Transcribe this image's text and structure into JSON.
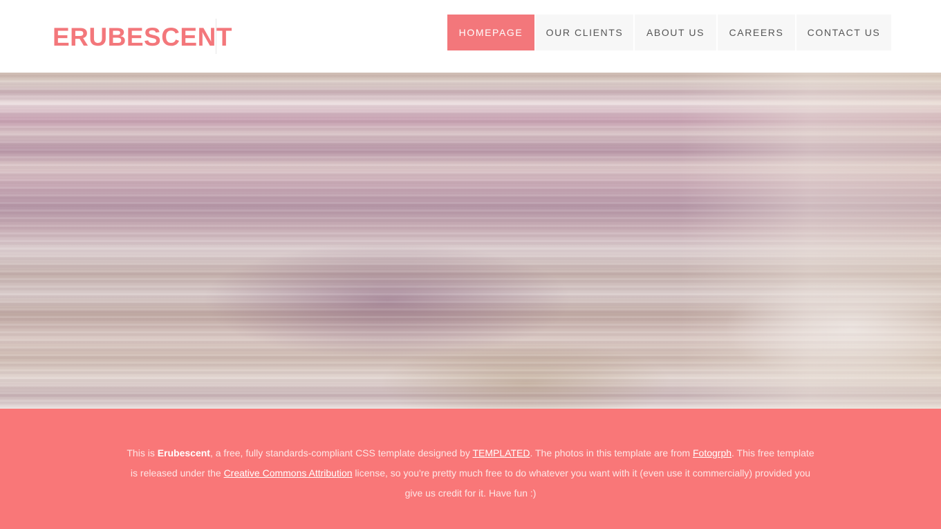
{
  "brand": {
    "logo": "ERUBESCENT",
    "accent_color": "#f3777b",
    "footer_bg": "#f97778"
  },
  "nav": {
    "items": [
      {
        "label": "HOMEPAGE",
        "active": true
      },
      {
        "label": "OUR CLIENTS",
        "active": false
      },
      {
        "label": "ABOUT US",
        "active": false
      },
      {
        "label": "CAREERS",
        "active": false
      },
      {
        "label": "CONTACT US",
        "active": false
      }
    ]
  },
  "banner": {
    "image": "blurred-pink-streaks-photo"
  },
  "footer": {
    "t1": "This is ",
    "brand_bold": "Erubescent",
    "t2": ", a free, fully standards-compliant CSS template designed by ",
    "link_templated": "TEMPLATED",
    "t3": ". The photos in this template are from ",
    "link_fotogrph": "Fotogrph",
    "t4": ". This free template is released under the ",
    "link_license": "Creative Commons Attribution",
    "t5": " license, so you're pretty much free to do whatever you want with it (even use it commercially) provided you give us credit for it. Have fun :)"
  }
}
